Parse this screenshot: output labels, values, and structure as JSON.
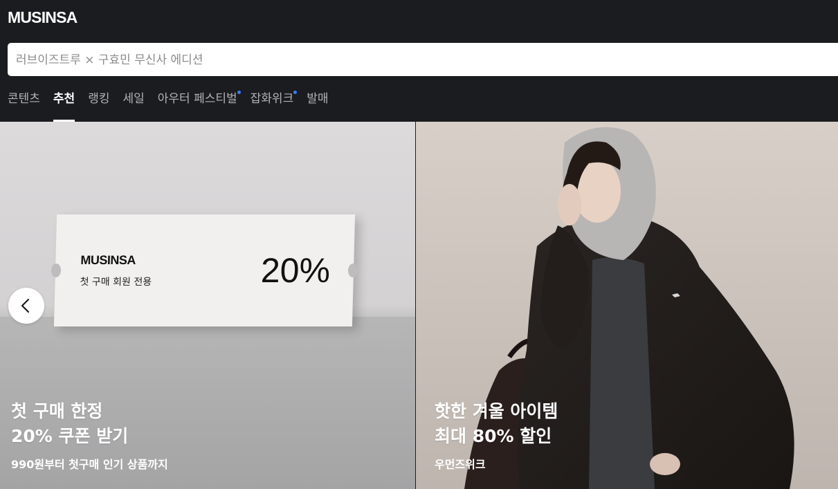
{
  "header": {
    "logo": "MUSINSA",
    "search_placeholder": "러브이즈트루 × 구효민 무신사 에디션"
  },
  "tabs": [
    {
      "label": "콘텐츠",
      "active": false,
      "dot": false
    },
    {
      "label": "추천",
      "active": true,
      "dot": false
    },
    {
      "label": "랭킹",
      "active": false,
      "dot": false
    },
    {
      "label": "세일",
      "active": false,
      "dot": false
    },
    {
      "label": "아우터 페스티벌",
      "active": false,
      "dot": true
    },
    {
      "label": "잡화위크",
      "active": false,
      "dot": true
    },
    {
      "label": "발매",
      "active": false,
      "dot": false
    }
  ],
  "banners": [
    {
      "ticket_brand": "MUSINSA",
      "ticket_sub": "첫 구매 회원 전용",
      "ticket_pct": "20%",
      "title_line1": "첫 구매 한정",
      "title_line2": "20% 쿠폰 받기",
      "subtitle": "990원부터 첫구매 인기 상품까지"
    },
    {
      "title_line1": "핫한 겨울 아이템",
      "title_line2": "최대 80% 할인",
      "subtitle": "우먼즈위크"
    }
  ],
  "controls": {
    "prev_icon": "chevron-left-icon"
  },
  "colors": {
    "header_bg": "#1b1c20",
    "tab_active": "#ffffff",
    "tab_inactive": "#b3b3b6",
    "dot_accent": "#3a7bff"
  }
}
